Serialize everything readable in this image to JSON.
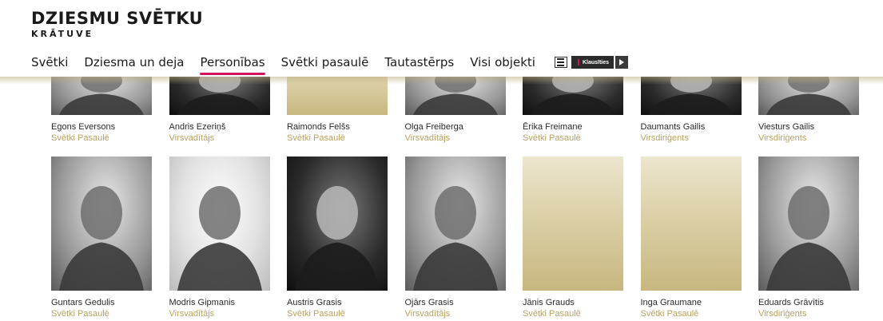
{
  "logo": {
    "line1": "DZIESMU SVĒTKU",
    "line2": "KRĀTUVE"
  },
  "nav": {
    "items": [
      {
        "label": "Svētki",
        "active": false
      },
      {
        "label": "Dziesma un deja",
        "active": false
      },
      {
        "label": "Personības",
        "active": true
      },
      {
        "label": "Svētki pasaulē",
        "active": false
      },
      {
        "label": "Tautastērps",
        "active": false
      },
      {
        "label": "Visi objekti",
        "active": false
      }
    ],
    "player": {
      "menu_icon": "menu-icon",
      "listen_label": "Klausīties",
      "play_icon": "play-icon"
    }
  },
  "colors": {
    "accent": "#d4145a",
    "role_text": "#b8a25e",
    "placeholder_gold": "#cdbf8a"
  },
  "people_row1": [
    {
      "name": "Egons Eversons",
      "role": "Svētki Pasaulē",
      "photo": "gray"
    },
    {
      "name": "Andris Ezeriņš",
      "role": "Virsvadītājs",
      "photo": "dark"
    },
    {
      "name": "Raimonds Felšs",
      "role": "Svētki Pasaulē",
      "photo": "gold"
    },
    {
      "name": "Olga Freiberga",
      "role": "Virsvadītājs",
      "photo": "gray"
    },
    {
      "name": "Ērika Freimane",
      "role": "Svētki Pasaulē",
      "photo": "dark"
    },
    {
      "name": "Daumants Gailis",
      "role": "Virsdiriģents",
      "photo": "dark"
    },
    {
      "name": "Viesturs Gailis",
      "role": "Virsdiriģents",
      "photo": "gray"
    }
  ],
  "people_row2": [
    {
      "name": "Guntars Gedulis",
      "role": "Svētki Pasaulē",
      "photo": "gray"
    },
    {
      "name": "Modris Gipmanis",
      "role": "Virsvadītājs",
      "photo": "light"
    },
    {
      "name": "Austris Grasis",
      "role": "Svētki Pasaulē",
      "photo": "dark"
    },
    {
      "name": "Ojārs Grasis",
      "role": "Virsvadītājs",
      "photo": "gray"
    },
    {
      "name": "Jānis Grauds",
      "role": "Svētki Pasaulē",
      "photo": "gold"
    },
    {
      "name": "Inga Graumane",
      "role": "Svētki Pasaulē",
      "photo": "gold"
    },
    {
      "name": "Eduards Grāvītis",
      "role": "Virsdiriģents",
      "photo": "gray"
    }
  ]
}
